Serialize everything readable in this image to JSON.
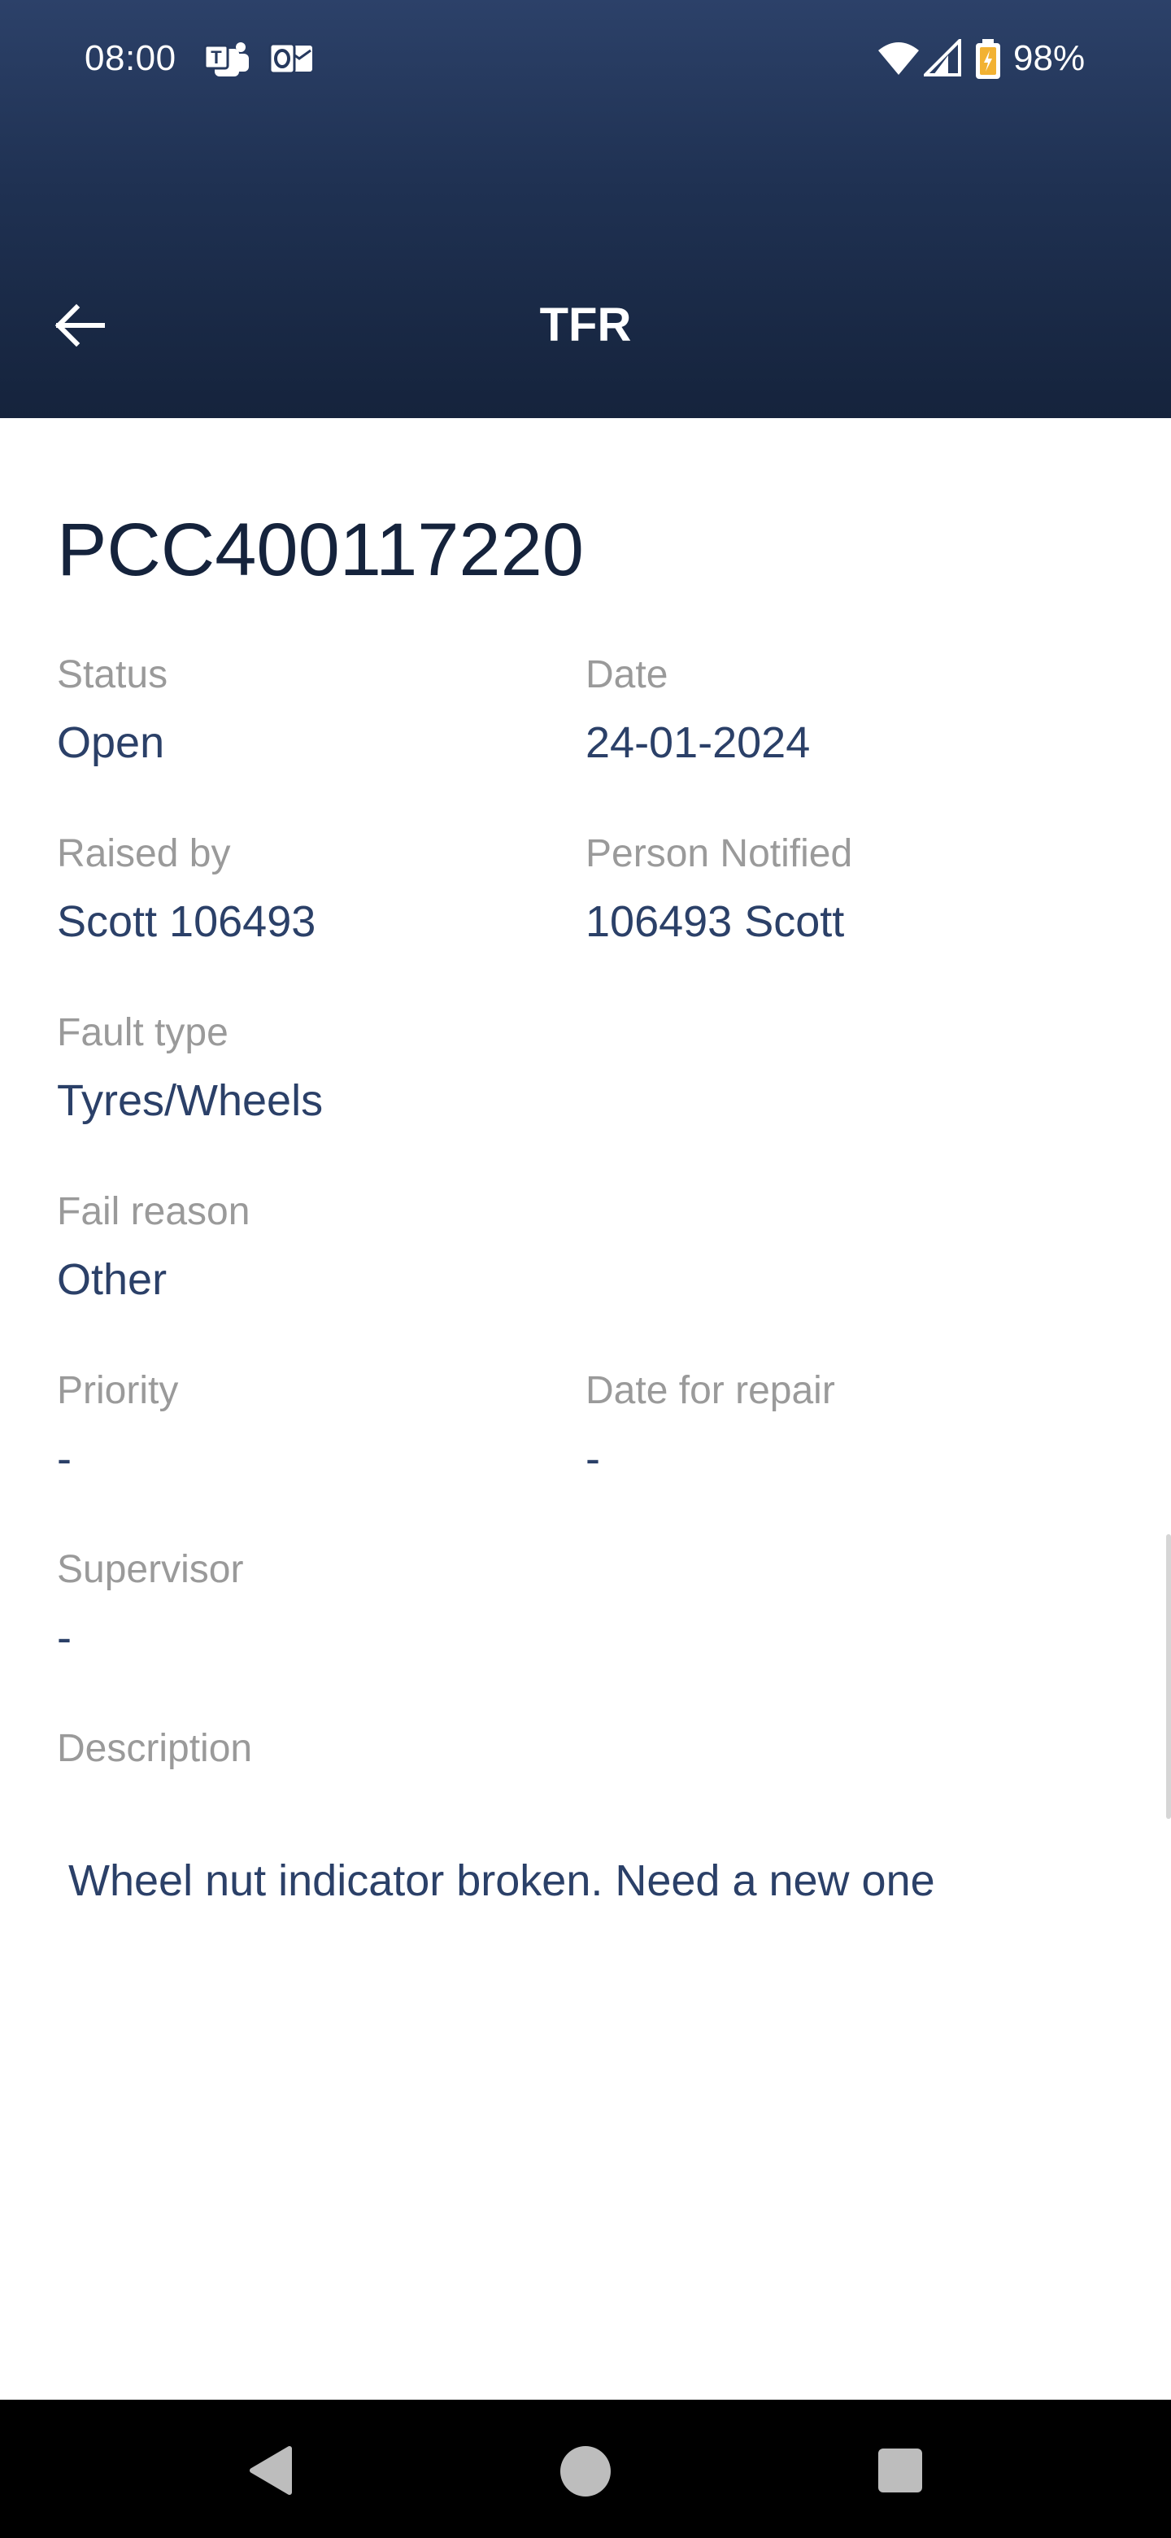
{
  "status_bar": {
    "time": "08:00",
    "battery": "98%",
    "icons": [
      "teams-icon",
      "outlook-icon",
      "wifi-icon",
      "cell-signal-icon",
      "battery-icon"
    ]
  },
  "header": {
    "title": "TFR",
    "back_icon": "arrow-left-icon",
    "gradient_top": "#2c4169",
    "gradient_bottom": "#15233c"
  },
  "record": {
    "id": "PCC400117220",
    "status_label": "Status",
    "status_value": "Open",
    "date_label": "Date",
    "date_value": "24-01-2024",
    "raised_by_label": "Raised by",
    "raised_by_value": "Scott 106493",
    "person_notified_label": "Person Notified",
    "person_notified_value": "106493 Scott",
    "fault_type_label": "Fault type",
    "fault_type_value": "Tyres/Wheels",
    "fail_reason_label": "Fail reason",
    "fail_reason_value": "Other",
    "priority_label": "Priority",
    "priority_value": "-",
    "date_for_repair_label": "Date for repair",
    "date_for_repair_value": "-",
    "supervisor_label": "Supervisor",
    "supervisor_value": "-",
    "description_label": "Description",
    "description_value": "Wheel nut indicator broken. Need a new one"
  },
  "colors": {
    "label": "#9a9a9a",
    "value": "#2b4068",
    "title": "#15233c"
  },
  "nav_bar": {
    "buttons": [
      "back-triangle-icon",
      "home-circle-icon",
      "recents-square-icon"
    ]
  }
}
